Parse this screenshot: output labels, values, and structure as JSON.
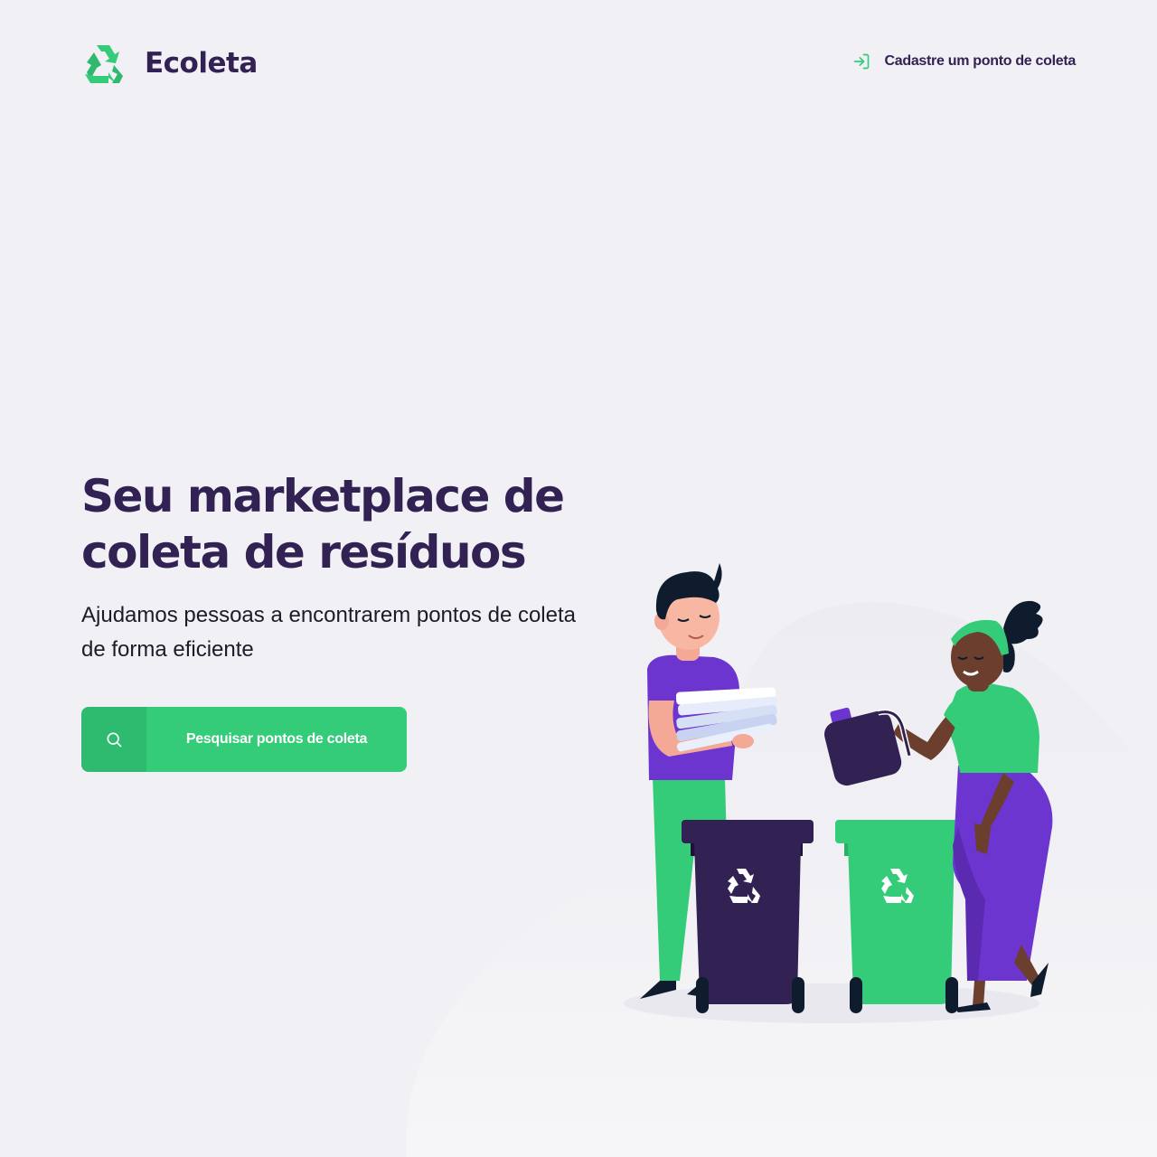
{
  "header": {
    "logo_text": "Ecoleta",
    "logo_icon": "recycle-icon",
    "link_icon": "log-in-icon",
    "link_label": "Cadastre um ponto de coleta"
  },
  "hero": {
    "title_line1": "Seu marketplace de",
    "title_line2": "coleta de resíduos",
    "subtitle_line1": "Ajudamos pessoas a encontrarem pontos de coleta",
    "subtitle_line2": "de forma eficiente"
  },
  "cta": {
    "icon": "search-icon",
    "label": "Pesquisar pontos de coleta"
  },
  "colors": {
    "background": "#F0F0F5",
    "primary": "#34CB79",
    "title": "#322153",
    "purple": "#6C35D0"
  }
}
